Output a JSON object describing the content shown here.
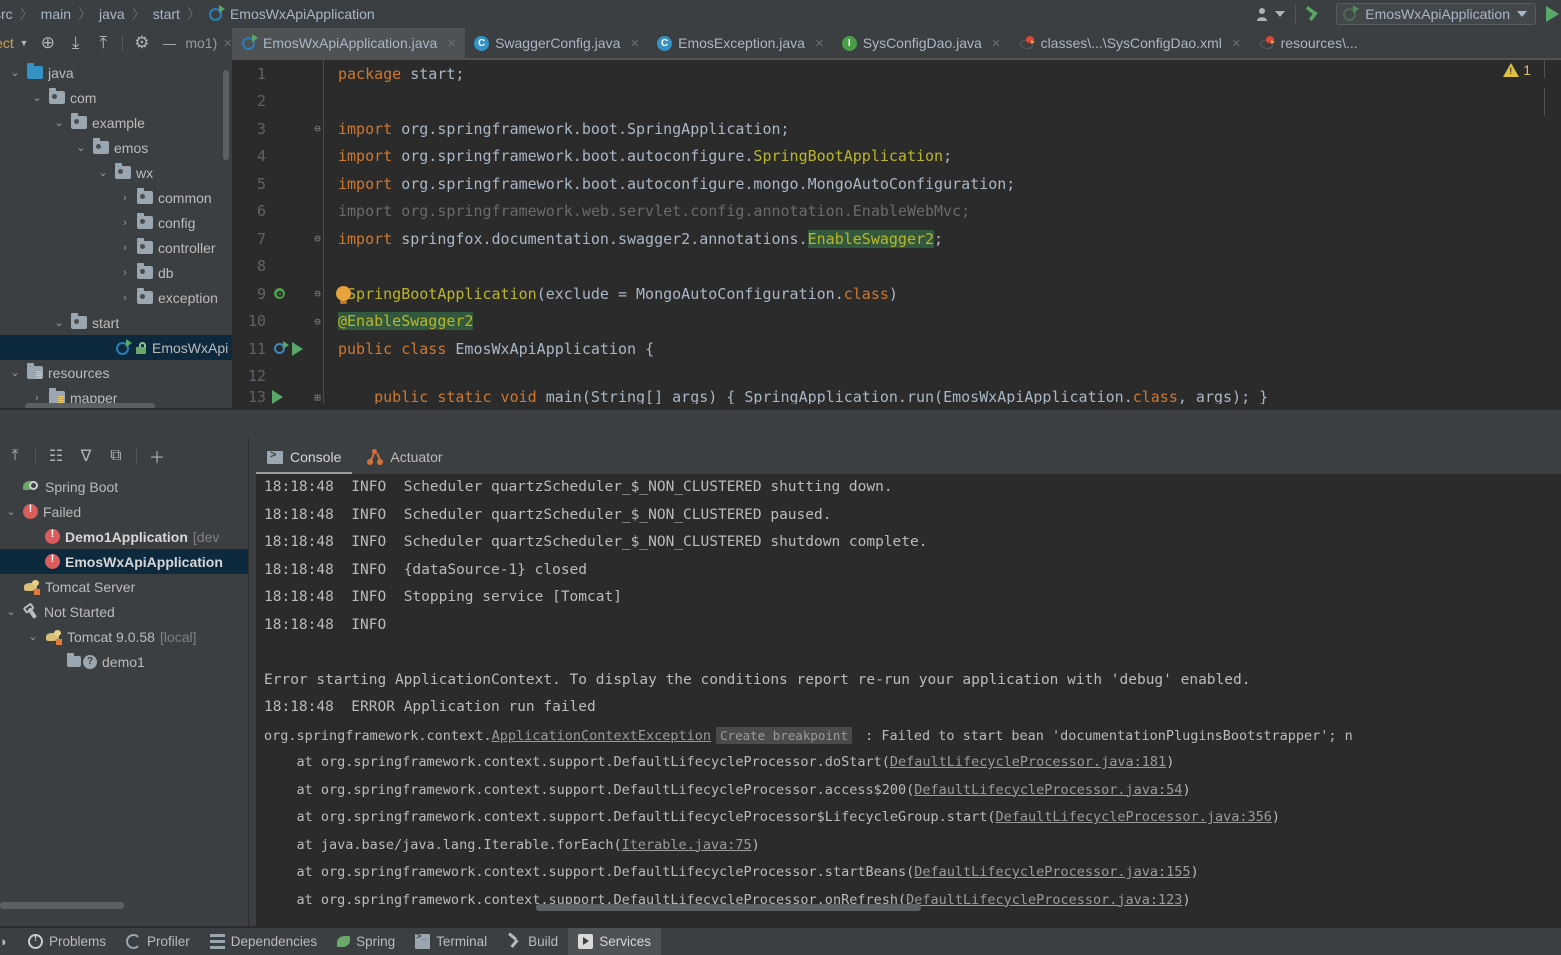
{
  "breadcrumb": {
    "items": [
      "src",
      "main",
      "java",
      "start",
      "EmosWxApiApplication"
    ],
    "separator": "〉"
  },
  "topbar": {
    "user_icon": "user-profile-icon",
    "build_icon": "hammer-icon",
    "run_config": "EmosWxApiApplication",
    "run_button": "run-icon"
  },
  "project_panel": {
    "title": "ject",
    "toolbar": [
      {
        "name": "project-view-dropdown",
        "glyph": "▼"
      },
      {
        "name": "locate-in-tree-icon",
        "glyph": "⊕"
      },
      {
        "name": "expand-all-icon",
        "glyph": "⤓"
      },
      {
        "name": "collapse-all-icon",
        "glyph": "⤒"
      },
      {
        "name": "settings-gear-icon",
        "glyph": "⚙"
      },
      {
        "name": "hide-panel-icon",
        "glyph": "—"
      }
    ],
    "tree": [
      {
        "label": "java",
        "indent": 0,
        "chev": "⌄",
        "icon": "folder-source",
        "selected": false
      },
      {
        "label": "com",
        "indent": 1,
        "chev": "⌄",
        "icon": "folder-package",
        "selected": false
      },
      {
        "label": "example",
        "indent": 2,
        "chev": "⌄",
        "icon": "folder-package",
        "selected": false
      },
      {
        "label": "emos",
        "indent": 3,
        "chev": "⌄",
        "icon": "folder-package",
        "selected": false
      },
      {
        "label": "wx",
        "indent": 4,
        "chev": "⌄",
        "icon": "folder-package",
        "selected": false
      },
      {
        "label": "common",
        "indent": 5,
        "chev": "›",
        "icon": "folder-package",
        "selected": false
      },
      {
        "label": "config",
        "indent": 5,
        "chev": "›",
        "icon": "folder-package",
        "selected": false
      },
      {
        "label": "controller",
        "indent": 5,
        "chev": "›",
        "icon": "folder-package",
        "selected": false
      },
      {
        "label": "db",
        "indent": 5,
        "chev": "›",
        "icon": "folder-package",
        "selected": false
      },
      {
        "label": "exception",
        "indent": 5,
        "chev": "›",
        "icon": "folder-package",
        "selected": false
      },
      {
        "label": "start",
        "indent": 2,
        "chev": "⌄",
        "icon": "folder-package",
        "selected": false
      },
      {
        "label": "EmosWxApiApplication",
        "indent": 4,
        "chev": "",
        "icon": "spring-class-lock",
        "selected": true
      },
      {
        "label": "resources",
        "indent": 0,
        "chev": "⌄",
        "icon": "folder-resources",
        "selected": false
      },
      {
        "label": "mapper",
        "indent": 1,
        "chev": "›",
        "icon": "folder-resources",
        "selected": false
      }
    ]
  },
  "editor_tabs": [
    {
      "label": "mo1)",
      "icon": "none",
      "active": false,
      "closable": true,
      "partial": true
    },
    {
      "label": "EmosWxApiApplication.java",
      "icon": "spring-class",
      "active": true,
      "closable": true
    },
    {
      "label": "SwaggerConfig.java",
      "icon": "class",
      "active": false,
      "closable": true
    },
    {
      "label": "EmosException.java",
      "icon": "class",
      "active": false,
      "closable": true
    },
    {
      "label": "SysConfigDao.java",
      "icon": "interface",
      "active": false,
      "closable": true
    },
    {
      "label": "classes\\...\\SysConfigDao.xml",
      "icon": "mybatis",
      "active": false,
      "closable": true
    },
    {
      "label": "resources\\...",
      "icon": "mybatis",
      "active": false,
      "closable": false
    }
  ],
  "editor": {
    "warning_count": "1",
    "lines": [
      {
        "num": "1",
        "tokens": [
          {
            "t": "package ",
            "c": "kw"
          },
          {
            "t": "start;",
            "c": "txt"
          }
        ]
      },
      {
        "num": "2",
        "tokens": []
      },
      {
        "num": "3",
        "fold": "⊖",
        "tokens": [
          {
            "t": "import ",
            "c": "kw"
          },
          {
            "t": "org.springframework.boot.SpringApplication;",
            "c": "txt"
          }
        ]
      },
      {
        "num": "4",
        "tokens": [
          {
            "t": "import ",
            "c": "kw"
          },
          {
            "t": "org.springframework.boot.autoconfigure.",
            "c": "txt"
          },
          {
            "t": "SpringBootApplication",
            "c": "ann"
          },
          {
            "t": ";",
            "c": "txt"
          }
        ]
      },
      {
        "num": "5",
        "tokens": [
          {
            "t": "import ",
            "c": "kw"
          },
          {
            "t": "org.springframework.boot.autoconfigure.mongo.MongoAutoConfiguration;",
            "c": "txt"
          }
        ]
      },
      {
        "num": "6",
        "tokens": [
          {
            "t": "import org.springframework.web.servlet.config.annotation.EnableWebMvc;",
            "c": "dim"
          }
        ]
      },
      {
        "num": "7",
        "fold": "⊖",
        "tokens": [
          {
            "t": "import ",
            "c": "kw"
          },
          {
            "t": "springfox.documentation.swagger2.annotations.",
            "c": "txt"
          },
          {
            "t": "EnableSwagger2",
            "c": "ann hl"
          },
          {
            "t": ";",
            "c": "txt"
          }
        ]
      },
      {
        "num": "8",
        "tokens": []
      },
      {
        "num": "9",
        "fold": "⊖",
        "gutter": [
          "spring-bean-icon"
        ],
        "bulb": true,
        "tokens": [
          {
            "t": "@SpringBootApplication",
            "c": "ann"
          },
          {
            "t": "(exclude = MongoAutoConfiguration.",
            "c": "txt"
          },
          {
            "t": "class",
            "c": "kw"
          },
          {
            "t": ")",
            "c": "txt"
          }
        ]
      },
      {
        "num": "10",
        "fold": "⊖",
        "tokens": [
          {
            "t": "@EnableSwagger2",
            "c": "ann hl"
          }
        ]
      },
      {
        "num": "11",
        "gutter": [
          "spring-config-icon",
          "run-icon"
        ],
        "tokens": [
          {
            "t": "public class ",
            "c": "kw"
          },
          {
            "t": "EmosWxApiApplication ",
            "c": "cls2"
          },
          {
            "t": "{",
            "c": "txt"
          }
        ]
      },
      {
        "num": "12",
        "tokens": []
      },
      {
        "num": "13",
        "clipped": true,
        "gutter": [
          "run-icon"
        ],
        "fold": "⊞",
        "tokens": [
          {
            "t": "    public static void ",
            "c": "kw"
          },
          {
            "t": "main(String[] args) { SpringApplication.run(EmosWxApiApplication.",
            "c": "txt"
          },
          {
            "t": "class",
            "c": "kw"
          },
          {
            "t": ", args); }",
            "c": "txt"
          }
        ]
      }
    ]
  },
  "services": {
    "toolbar": [
      {
        "name": "collapse-all-icon",
        "glyph": "⤒"
      },
      {
        "name": "group-by-icon",
        "glyph": "☷"
      },
      {
        "name": "filter-icon",
        "glyph": "∇"
      },
      {
        "name": "add-frame-icon",
        "glyph": "⧉"
      },
      {
        "name": "add-service-icon",
        "glyph": "＋"
      }
    ],
    "tree": [
      {
        "label": "Spring Boot",
        "indent": 0,
        "chev": "",
        "icon": "spring-leaf-icon",
        "bold": false,
        "selected": false
      },
      {
        "label": "Failed",
        "indent": 0,
        "chev": "⌄",
        "icon": "error-icon",
        "bold": false,
        "selected": false
      },
      {
        "label": "Demo1Application",
        "suffix": " [dev",
        "indent": 1,
        "chev": "",
        "icon": "error-icon",
        "bold": true,
        "selected": false
      },
      {
        "label": "EmosWxApiApplication",
        "indent": 1,
        "chev": "",
        "icon": "error-icon",
        "bold": true,
        "selected": true
      },
      {
        "label": "Tomcat Server",
        "indent": 0,
        "chev": "",
        "icon": "tomcat-icon",
        "bold": false,
        "selected": false
      },
      {
        "label": "Not Started",
        "indent": 0,
        "chev": "⌄",
        "icon": "wrench-icon",
        "bold": false,
        "selected": false
      },
      {
        "label": "Tomcat 9.0.58",
        "suffix": " [local]",
        "indent": 1,
        "chev": "⌄",
        "icon": "tomcat-icon",
        "bold": false,
        "selected": false
      },
      {
        "label": "demo1",
        "indent": 2,
        "chev": "",
        "icon": "folder-question-icon",
        "bold": false,
        "selected": false
      }
    ]
  },
  "console": {
    "tabs": [
      {
        "label": "Console",
        "icon": "console-icon",
        "active": true
      },
      {
        "label": "Actuator",
        "icon": "actuator-icon",
        "active": false
      }
    ],
    "lines": [
      {
        "kind": "log",
        "ts": "18:18:48",
        "level": "INFO",
        "msg": "Scheduler quartzScheduler_$_NON_CLUSTERED shutting down."
      },
      {
        "kind": "log",
        "ts": "18:18:48",
        "level": "INFO",
        "msg": "Scheduler quartzScheduler_$_NON_CLUSTERED paused."
      },
      {
        "kind": "log",
        "ts": "18:18:48",
        "level": "INFO",
        "msg": "Scheduler quartzScheduler_$_NON_CLUSTERED shutdown complete."
      },
      {
        "kind": "log",
        "ts": "18:18:48",
        "level": "INFO",
        "msg": "{dataSource-1} closed"
      },
      {
        "kind": "log",
        "ts": "18:18:48",
        "level": "INFO",
        "msg": "Stopping service [Tomcat]"
      },
      {
        "kind": "log",
        "ts": "18:18:48",
        "level": "INFO",
        "msg": ""
      },
      {
        "kind": "blank"
      },
      {
        "kind": "plain",
        "text": "Error starting ApplicationContext. To display the conditions report re-run your application with 'debug' enabled."
      },
      {
        "kind": "log",
        "ts": "18:18:48",
        "level": "ERROR",
        "msg": "Application run failed"
      },
      {
        "kind": "exception",
        "pre": "org.springframework.context.",
        "link": "ApplicationContextException",
        "chip": "Create breakpoint",
        "post": " : Failed to start bean 'documentationPluginsBootstrapper'; n"
      },
      {
        "kind": "stack",
        "pre": "    at org.springframework.context.support.DefaultLifecycleProcessor.doStart(",
        "link": "DefaultLifecycleProcessor.java:181",
        "post": ")"
      },
      {
        "kind": "stack",
        "pre": "    at org.springframework.context.support.DefaultLifecycleProcessor.access$200(",
        "link": "DefaultLifecycleProcessor.java:54",
        "post": ")"
      },
      {
        "kind": "stack",
        "pre": "    at org.springframework.context.support.DefaultLifecycleProcessor$LifecycleGroup.start(",
        "link": "DefaultLifecycleProcessor.java:356",
        "post": ")"
      },
      {
        "kind": "stack",
        "pre": "    at java.base/java.lang.Iterable.forEach(",
        "link": "Iterable.java:75",
        "post": ")"
      },
      {
        "kind": "stack",
        "pre": "    at org.springframework.context.support.DefaultLifecycleProcessor.startBeans(",
        "link": "DefaultLifecycleProcessor.java:155",
        "post": ")"
      },
      {
        "kind": "stack",
        "pre": "    at org.springframework.context.support.DefaultLifecycleProcessor.onRefresh(",
        "link": "DefaultLifecycleProcessor.java:123",
        "post": ")"
      }
    ]
  },
  "statusbar": {
    "items": [
      {
        "label": "",
        "icon": "none",
        "active": false
      },
      {
        "label": "Problems",
        "icon": "problems-icon",
        "active": false
      },
      {
        "label": "Profiler",
        "icon": "profiler-icon",
        "active": false
      },
      {
        "label": "Dependencies",
        "icon": "dependencies-icon",
        "active": false
      },
      {
        "label": "Spring",
        "icon": "spring-leaf-icon",
        "active": false
      },
      {
        "label": "Terminal",
        "icon": "terminal-icon",
        "active": false
      },
      {
        "label": "Build",
        "icon": "build-hammer-icon",
        "active": false
      },
      {
        "label": "Services",
        "icon": "services-icon",
        "active": true
      }
    ]
  },
  "colors": {
    "panel_bg": "#3c3f41",
    "editor_bg": "#2b2b2b",
    "selection_bg": "#0d293e",
    "accent_blue": "#3592c4",
    "spring_green": "#59a869",
    "keyword_orange": "#cc7832",
    "annotation_yellow": "#bbb529",
    "error_red": "#db5c5c",
    "warning_yellow": "#e0c040",
    "text": "#bbbbbb"
  }
}
